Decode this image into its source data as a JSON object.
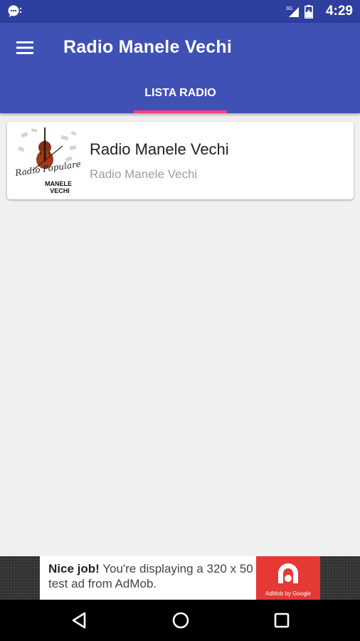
{
  "status_bar": {
    "time": "4:29",
    "network": "3G",
    "icons": [
      "chat-notification-icon",
      "signal-3g-icon",
      "battery-charging-icon"
    ]
  },
  "app_bar": {
    "title": "Radio Manele Vechi",
    "menu_icon": "hamburger-menu-icon",
    "tabs": [
      {
        "label": "LISTA RADIO",
        "active": true
      }
    ]
  },
  "stations": [
    {
      "title": "Radio Manele Vechi",
      "subtitle": "Radio Manele Vechi",
      "logo_lines": [
        "Radio Populare",
        "MANELE",
        "VECHI"
      ]
    }
  ],
  "ad_banner": {
    "headline": "Nice job!",
    "text": " You're displaying a 320 x 50 test ad from AdMob.",
    "logo_caption": "AdMob by Google"
  },
  "nav_bar": {
    "buttons": [
      "back-icon",
      "home-icon",
      "recents-icon"
    ]
  },
  "colors": {
    "status_bar": "#2f3fa0",
    "primary": "#3f51b5",
    "accent": "#ff4081",
    "background": "#f0f0f0",
    "ad_logo": "#e53935"
  }
}
